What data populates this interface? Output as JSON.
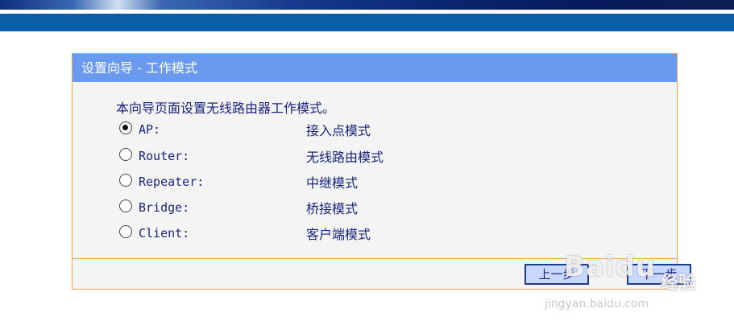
{
  "page": {
    "title": "设置向导 - 工作模式",
    "intro": "本向导页面设置无线路由器工作模式。"
  },
  "modes": [
    {
      "label": "AP:",
      "desc": "接入点模式",
      "checked": true
    },
    {
      "label": "Router:",
      "desc": "无线路由模式",
      "checked": false
    },
    {
      "label": "Repeater:",
      "desc": "中继模式",
      "checked": false
    },
    {
      "label": "Bridge:",
      "desc": "桥接模式",
      "checked": false
    },
    {
      "label": "Client:",
      "desc": "客户端模式",
      "checked": false
    }
  ],
  "buttons": {
    "prev": "上一步",
    "next": "下一步"
  },
  "watermark": {
    "logo": "Baidu",
    "sub": "经验",
    "url": "jingyan.baidu.com"
  },
  "colors": {
    "title_bar": "#6a9af0",
    "panel_border": "#f3a34a",
    "header_bar": "#0c5ea6",
    "text": "#1a237e"
  }
}
